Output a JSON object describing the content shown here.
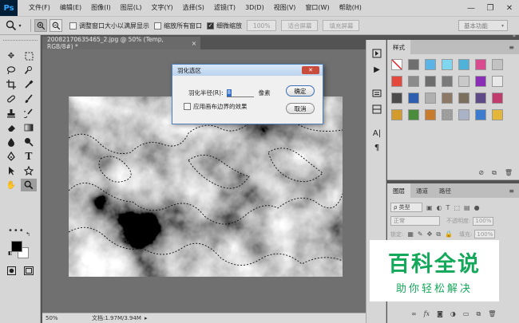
{
  "app": {
    "logo": "Ps"
  },
  "menu": [
    "文件(F)",
    "编辑(E)",
    "图像(I)",
    "图层(L)",
    "文字(Y)",
    "选择(S)",
    "滤镜(T)",
    "3D(D)",
    "视图(V)",
    "窗口(W)",
    "帮助(H)"
  ],
  "window_controls": {
    "minimize": "—",
    "restore": "❐",
    "close": "✕"
  },
  "options": {
    "tool_icon": "zoom-icon",
    "resize_windows": "调整窗口大小以满屏显示",
    "zoom_all": "缩放所有窗口",
    "scrubby_zoom": "细微缩放",
    "zoom_pct_button": "100%",
    "fit_screen": "适合屏幕",
    "fill_screen": "填充屏幕",
    "workspace": "基本功能"
  },
  "document": {
    "tab_title": "20082170635465_2.jpg @ 50% (Temp, RGB/8#) *",
    "close": "×",
    "status_zoom": "50%",
    "status_doc": "文档:1.97M/3.94M"
  },
  "dialog": {
    "title": "羽化选区",
    "radius_label": "羽化半径(R):",
    "radius_value": "8",
    "unit": "像素",
    "ok": "确定",
    "cancel": "取消",
    "apply_canvas": "应用画布边界的效果",
    "close": "✕"
  },
  "panels": {
    "styles_tab": "样式",
    "layers_tabs": [
      "图层",
      "通道",
      "路径"
    ],
    "kind": "ρ 类型",
    "blend_mode": "正常",
    "opacity_label": "不透明度:",
    "opacity_value": "100%",
    "lock_label": "锁定:",
    "fill_label": "填充:",
    "fill_value": "100%",
    "menu": "≡",
    "collapse": "»"
  },
  "style_colors": [
    "#ffffff",
    "#6f6f6f",
    "#5ab4e6",
    "#7fd6ee",
    "#4fb3d9",
    "#d84c8f",
    "#c2c2c2",
    "#e5493e",
    "#8b8b8b",
    "#6d6d6d",
    "#7a7a7a",
    "#c9c9c9",
    "#8a2fb5",
    "#e8e8e8",
    "#4c4c4c",
    "#2d5fae",
    "#b0b0b0",
    "#8c7a66",
    "#7d6f5d",
    "#5d4a86",
    "#c13b6d",
    "#d39a2c",
    "#4a8c3c",
    "#c97b2e",
    "#9e9e9e",
    "#aab3c6",
    "#3d7ccc",
    "#e4b73a"
  ],
  "watermark": {
    "title": "百科全说",
    "subtitle": "助你轻松解决"
  }
}
